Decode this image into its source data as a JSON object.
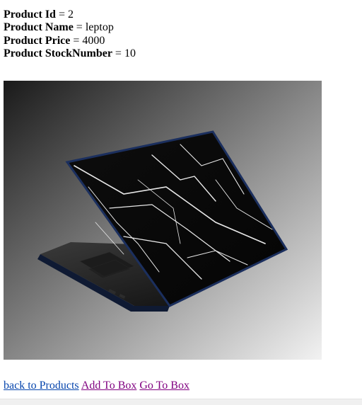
{
  "product": {
    "id_label": "Product Id",
    "id_value": "2",
    "name_label": "Product Name",
    "name_value": "leptop",
    "price_label": "Product Price",
    "price_value": "4000",
    "stock_label": "Product StockNumber",
    "stock_value": "10",
    "separator": " = "
  },
  "image": {
    "subject": "laptop with black marble skin",
    "icon": "laptop-image"
  },
  "links": {
    "back": "back to Products",
    "add": "Add To Box",
    "go": "Go To Box"
  },
  "colors": {
    "link": "#0645ad",
    "visited_link": "#800080"
  }
}
